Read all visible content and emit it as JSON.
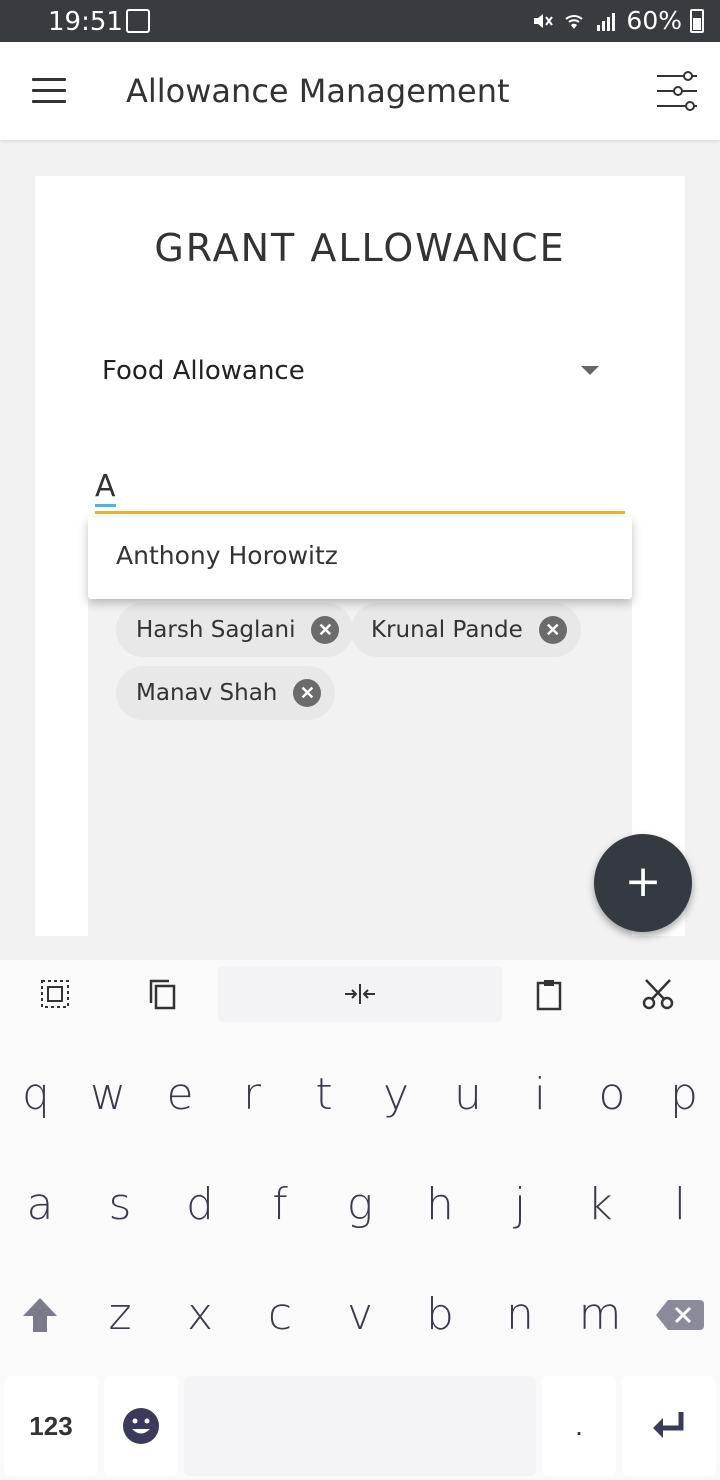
{
  "status_bar": {
    "time": "19:51",
    "battery": "60%",
    "icons": [
      "hand-icon",
      "mute-icon",
      "wifi-icon",
      "signal-icon",
      "battery-icon"
    ]
  },
  "app_bar": {
    "title": "Allowance Management",
    "icons": [
      "menu-icon",
      "filter-icon"
    ]
  },
  "card": {
    "title": "GRANT ALLOWANCE",
    "allowance_select": {
      "value": "Food Allowance"
    },
    "employee_input": {
      "value": "A"
    },
    "suggestions": [
      "Anthony Horowitz"
    ],
    "chips": [
      {
        "label": "Harsh Saglani"
      },
      {
        "label": "Krunal Pande"
      },
      {
        "label": "Manav Shah"
      }
    ]
  },
  "fab": {
    "label": "+"
  },
  "keyboard": {
    "toolbar": [
      "select-all-icon",
      "copy-icon",
      "cursor-icon",
      "paste-icon",
      "cut-icon"
    ],
    "rows": [
      [
        "q",
        "w",
        "e",
        "r",
        "t",
        "y",
        "u",
        "i",
        "o",
        "p"
      ],
      [
        "a",
        "s",
        "d",
        "f",
        "g",
        "h",
        "j",
        "k",
        "l"
      ],
      [
        "z",
        "x",
        "c",
        "v",
        "b",
        "n",
        "m"
      ]
    ],
    "numbers_key": "123",
    "period_key": "."
  },
  "colors": {
    "status_bar": "#383b40",
    "accent_underline": "#e6b43a",
    "cursor_underline": "#4db6e8",
    "fab": "#353940"
  }
}
